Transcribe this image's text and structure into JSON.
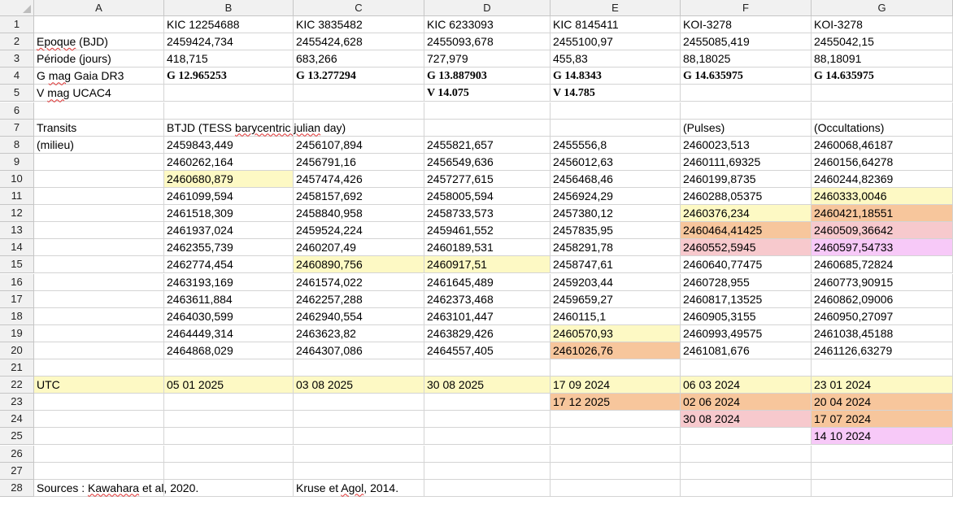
{
  "columns": [
    "A",
    "B",
    "C",
    "D",
    "E",
    "F",
    "G"
  ],
  "rows": [
    "1",
    "2",
    "3",
    "4",
    "5",
    "6",
    "7",
    "8",
    "9",
    "10",
    "11",
    "12",
    "13",
    "14",
    "15",
    "16",
    "17",
    "18",
    "19",
    "20",
    "21",
    "22",
    "23",
    "24",
    "25",
    "26",
    "27",
    "28"
  ],
  "colors": {
    "yellow": "#fdf9c4",
    "orange": "#f7c69c",
    "pink": "#f7c9cd",
    "violet": "#f7c9f8"
  },
  "cells": [
    {
      "r": 1,
      "c": "B",
      "v": "KIC 12254688"
    },
    {
      "r": 1,
      "c": "C",
      "v": "KIC 3835482"
    },
    {
      "r": 1,
      "c": "D",
      "v": "KIC 6233093"
    },
    {
      "r": 1,
      "c": "E",
      "v": "KIC 8145411"
    },
    {
      "r": 1,
      "c": "F",
      "v": "KOI-3278"
    },
    {
      "r": 1,
      "c": "G",
      "v": "KOI-3278"
    },
    {
      "r": 2,
      "c": "A",
      "v": "Epoque  (BJD)"
    },
    {
      "r": 2,
      "c": "B",
      "v": "2459424,734"
    },
    {
      "r": 2,
      "c": "C",
      "v": "2455424,628"
    },
    {
      "r": 2,
      "c": "D",
      "v": "2455093,678"
    },
    {
      "r": 2,
      "c": "E",
      "v": "2455100,97"
    },
    {
      "r": 2,
      "c": "F",
      "v": "2455085,419"
    },
    {
      "r": 2,
      "c": "G",
      "v": "2455042,15"
    },
    {
      "r": 3,
      "c": "A",
      "v": "Période (jours)"
    },
    {
      "r": 3,
      "c": "B",
      "v": "418,715"
    },
    {
      "r": 3,
      "c": "C",
      "v": "683,266"
    },
    {
      "r": 3,
      "c": "D",
      "v": "727,979"
    },
    {
      "r": 3,
      "c": "E",
      "v": "455,83"
    },
    {
      "r": 3,
      "c": "F",
      "v": "88,18025"
    },
    {
      "r": 3,
      "c": "G",
      "v": "88,18091"
    },
    {
      "r": 4,
      "c": "A",
      "v": "G mag Gaia DR3"
    },
    {
      "r": 4,
      "c": "B",
      "v": "G 12.965253",
      "bold": true
    },
    {
      "r": 4,
      "c": "C",
      "v": "G 13.277294",
      "bold": true
    },
    {
      "r": 4,
      "c": "D",
      "v": "G 13.887903",
      "bold": true
    },
    {
      "r": 4,
      "c": "E",
      "v": "G 14.8343",
      "bold": true
    },
    {
      "r": 4,
      "c": "F",
      "v": "G 14.635975",
      "bold": true
    },
    {
      "r": 4,
      "c": "G",
      "v": "G 14.635975",
      "bold": true
    },
    {
      "r": 5,
      "c": "A",
      "v": "V mag UCAC4"
    },
    {
      "r": 5,
      "c": "D",
      "v": "V 14.075",
      "bold": true
    },
    {
      "r": 5,
      "c": "E",
      "v": "V 14.785",
      "bold": true
    },
    {
      "r": 7,
      "c": "A",
      "v": "Transits"
    },
    {
      "r": 7,
      "c": "B",
      "v": "BTJD (TESS barycentric julian day)"
    },
    {
      "r": 7,
      "c": "F",
      "v": "(Pulses)"
    },
    {
      "r": 7,
      "c": "G",
      "v": "(Occultations)"
    },
    {
      "r": 8,
      "c": "A",
      "v": "(milieu)"
    },
    {
      "r": 8,
      "c": "B",
      "v": "2459843,449"
    },
    {
      "r": 8,
      "c": "C",
      "v": "2456107,894"
    },
    {
      "r": 8,
      "c": "D",
      "v": "2455821,657"
    },
    {
      "r": 8,
      "c": "E",
      "v": "2455556,8"
    },
    {
      "r": 8,
      "c": "F",
      "v": "2460023,513"
    },
    {
      "r": 8,
      "c": "G",
      "v": "2460068,46187"
    },
    {
      "r": 9,
      "c": "B",
      "v": "2460262,164"
    },
    {
      "r": 9,
      "c": "C",
      "v": "2456791,16"
    },
    {
      "r": 9,
      "c": "D",
      "v": "2456549,636"
    },
    {
      "r": 9,
      "c": "E",
      "v": "2456012,63"
    },
    {
      "r": 9,
      "c": "F",
      "v": "2460111,69325"
    },
    {
      "r": 9,
      "c": "G",
      "v": "2460156,64278"
    },
    {
      "r": 10,
      "c": "B",
      "v": "2460680,879",
      "fill": "yellow"
    },
    {
      "r": 10,
      "c": "C",
      "v": "2457474,426"
    },
    {
      "r": 10,
      "c": "D",
      "v": "2457277,615"
    },
    {
      "r": 10,
      "c": "E",
      "v": "2456468,46"
    },
    {
      "r": 10,
      "c": "F",
      "v": "2460199,8735"
    },
    {
      "r": 10,
      "c": "G",
      "v": "2460244,82369"
    },
    {
      "r": 11,
      "c": "B",
      "v": "2461099,594"
    },
    {
      "r": 11,
      "c": "C",
      "v": "2458157,692"
    },
    {
      "r": 11,
      "c": "D",
      "v": "2458005,594"
    },
    {
      "r": 11,
      "c": "E",
      "v": "2456924,29"
    },
    {
      "r": 11,
      "c": "F",
      "v": "2460288,05375"
    },
    {
      "r": 11,
      "c": "G",
      "v": "2460333,0046",
      "fill": "yellow"
    },
    {
      "r": 12,
      "c": "B",
      "v": "2461518,309"
    },
    {
      "r": 12,
      "c": "C",
      "v": "2458840,958"
    },
    {
      "r": 12,
      "c": "D",
      "v": "2458733,573"
    },
    {
      "r": 12,
      "c": "E",
      "v": "2457380,12"
    },
    {
      "r": 12,
      "c": "F",
      "v": "2460376,234",
      "fill": "yellow"
    },
    {
      "r": 12,
      "c": "G",
      "v": "2460421,18551",
      "fill": "orange"
    },
    {
      "r": 13,
      "c": "B",
      "v": "2461937,024"
    },
    {
      "r": 13,
      "c": "C",
      "v": "2459524,224"
    },
    {
      "r": 13,
      "c": "D",
      "v": "2459461,552"
    },
    {
      "r": 13,
      "c": "E",
      "v": "2457835,95"
    },
    {
      "r": 13,
      "c": "F",
      "v": "2460464,41425",
      "fill": "orange"
    },
    {
      "r": 13,
      "c": "G",
      "v": "2460509,36642",
      "fill": "pink"
    },
    {
      "r": 14,
      "c": "B",
      "v": "2462355,739"
    },
    {
      "r": 14,
      "c": "C",
      "v": "2460207,49"
    },
    {
      "r": 14,
      "c": "D",
      "v": "2460189,531"
    },
    {
      "r": 14,
      "c": "E",
      "v": "2458291,78"
    },
    {
      "r": 14,
      "c": "F",
      "v": "2460552,5945",
      "fill": "pink"
    },
    {
      "r": 14,
      "c": "G",
      "v": "2460597,54733",
      "fill": "violet"
    },
    {
      "r": 15,
      "c": "B",
      "v": "2462774,454"
    },
    {
      "r": 15,
      "c": "C",
      "v": "2460890,756",
      "fill": "yellow"
    },
    {
      "r": 15,
      "c": "D",
      "v": "2460917,51",
      "fill": "yellow"
    },
    {
      "r": 15,
      "c": "E",
      "v": "2458747,61"
    },
    {
      "r": 15,
      "c": "F",
      "v": "2460640,77475"
    },
    {
      "r": 15,
      "c": "G",
      "v": "2460685,72824"
    },
    {
      "r": 16,
      "c": "B",
      "v": "2463193,169"
    },
    {
      "r": 16,
      "c": "C",
      "v": "2461574,022"
    },
    {
      "r": 16,
      "c": "D",
      "v": "2461645,489"
    },
    {
      "r": 16,
      "c": "E",
      "v": "2459203,44"
    },
    {
      "r": 16,
      "c": "F",
      "v": "2460728,955"
    },
    {
      "r": 16,
      "c": "G",
      "v": "2460773,90915"
    },
    {
      "r": 17,
      "c": "B",
      "v": "2463611,884"
    },
    {
      "r": 17,
      "c": "C",
      "v": "2462257,288"
    },
    {
      "r": 17,
      "c": "D",
      "v": "2462373,468"
    },
    {
      "r": 17,
      "c": "E",
      "v": "2459659,27"
    },
    {
      "r": 17,
      "c": "F",
      "v": "2460817,13525"
    },
    {
      "r": 17,
      "c": "G",
      "v": "2460862,09006"
    },
    {
      "r": 18,
      "c": "B",
      "v": "2464030,599"
    },
    {
      "r": 18,
      "c": "C",
      "v": "2462940,554"
    },
    {
      "r": 18,
      "c": "D",
      "v": "2463101,447"
    },
    {
      "r": 18,
      "c": "E",
      "v": "2460115,1"
    },
    {
      "r": 18,
      "c": "F",
      "v": "2460905,3155"
    },
    {
      "r": 18,
      "c": "G",
      "v": "2460950,27097"
    },
    {
      "r": 19,
      "c": "B",
      "v": "2464449,314"
    },
    {
      "r": 19,
      "c": "C",
      "v": "2463623,82"
    },
    {
      "r": 19,
      "c": "D",
      "v": "2463829,426"
    },
    {
      "r": 19,
      "c": "E",
      "v": "2460570,93",
      "fill": "yellow"
    },
    {
      "r": 19,
      "c": "F",
      "v": "2460993,49575"
    },
    {
      "r": 19,
      "c": "G",
      "v": "2461038,45188"
    },
    {
      "r": 20,
      "c": "B",
      "v": "2464868,029"
    },
    {
      "r": 20,
      "c": "C",
      "v": "2464307,086"
    },
    {
      "r": 20,
      "c": "D",
      "v": "2464557,405"
    },
    {
      "r": 20,
      "c": "E",
      "v": "2461026,76",
      "fill": "orange"
    },
    {
      "r": 20,
      "c": "F",
      "v": "2461081,676"
    },
    {
      "r": 20,
      "c": "G",
      "v": "2461126,63279"
    },
    {
      "r": 22,
      "c": "A",
      "v": "UTC",
      "fill": "yellow"
    },
    {
      "r": 22,
      "c": "B",
      "v": "05 01 2025",
      "fill": "yellow"
    },
    {
      "r": 22,
      "c": "C",
      "v": "03 08 2025",
      "fill": "yellow"
    },
    {
      "r": 22,
      "c": "D",
      "v": "30 08 2025",
      "fill": "yellow"
    },
    {
      "r": 22,
      "c": "E",
      "v": "17 09 2024",
      "fill": "yellow"
    },
    {
      "r": 22,
      "c": "F",
      "v": "06 03 2024",
      "fill": "yellow"
    },
    {
      "r": 22,
      "c": "G",
      "v": "23 01 2024",
      "fill": "yellow"
    },
    {
      "r": 23,
      "c": "E",
      "v": "17 12 2025",
      "fill": "orange"
    },
    {
      "r": 23,
      "c": "F",
      "v": "02 06 2024",
      "fill": "orange"
    },
    {
      "r": 23,
      "c": "G",
      "v": "20 04 2024",
      "fill": "orange"
    },
    {
      "r": 24,
      "c": "F",
      "v": "30 08 2024",
      "fill": "pink"
    },
    {
      "r": 24,
      "c": "G",
      "v": "17 07 2024",
      "fill": "orange"
    },
    {
      "r": 25,
      "c": "G",
      "v": "14 10 2024",
      "fill": "violet"
    },
    {
      "r": 28,
      "c": "A",
      "v": "Sources : Kawahara et al, 2020."
    },
    {
      "r": 28,
      "c": "C",
      "v": "Kruse et Agol, 2014."
    }
  ]
}
